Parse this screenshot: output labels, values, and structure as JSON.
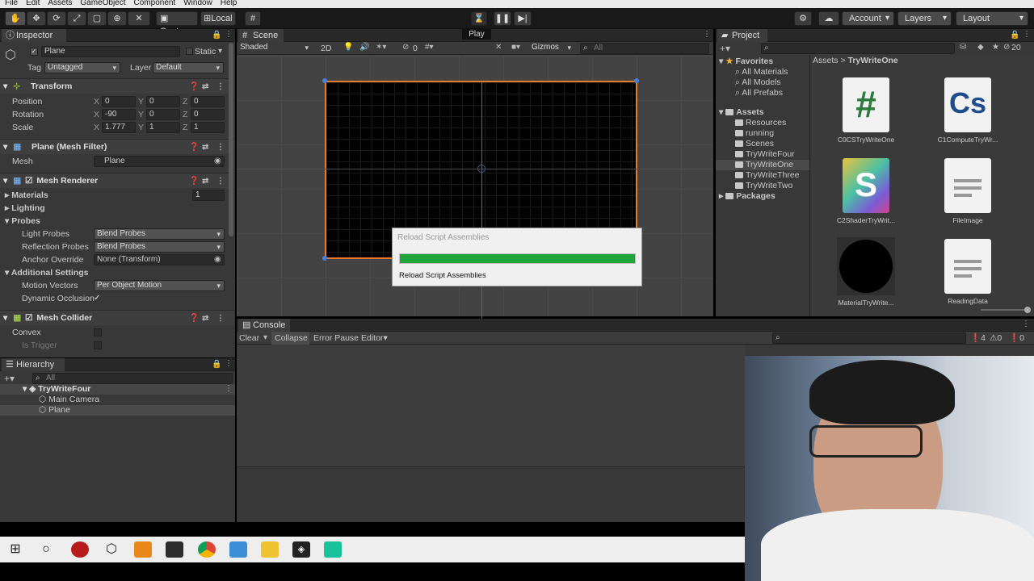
{
  "menu": [
    "File",
    "Edit",
    "Assets",
    "GameObject",
    "Component",
    "Window",
    "Help"
  ],
  "toolbar": {
    "center": "Center",
    "local": "Local",
    "play_label": "Play",
    "account": "Account",
    "layers": "Layers",
    "layout": "Layout"
  },
  "inspector": {
    "tab": "Inspector",
    "name": "Plane",
    "static": "Static",
    "tag_label": "Tag",
    "tag": "Untagged",
    "layer_label": "Layer",
    "layer": "Default",
    "transform": {
      "title": "Transform",
      "position": {
        "label": "Position",
        "x": "0",
        "y": "0",
        "z": "0"
      },
      "rotation": {
        "label": "Rotation",
        "x": "-90",
        "y": "0",
        "z": "0"
      },
      "scale": {
        "label": "Scale",
        "x": "1.777",
        "y": "1",
        "z": "1"
      }
    },
    "mesh_filter": {
      "title": "Plane (Mesh Filter)",
      "mesh_label": "Mesh",
      "mesh": "Plane"
    },
    "mesh_renderer": {
      "title": "Mesh Renderer",
      "materials": "Materials",
      "materials_count": "1",
      "lighting": "Lighting",
      "probes": "Probes",
      "light_probes_label": "Light Probes",
      "light_probes": "Blend Probes",
      "reflection_probes_label": "Reflection Probes",
      "reflection_probes": "Blend Probes",
      "anchor_label": "Anchor Override",
      "anchor": "None (Transform)",
      "additional": "Additional Settings",
      "motion_label": "Motion Vectors",
      "motion": "Per Object Motion",
      "dynamic_label": "Dynamic Occlusion"
    },
    "mesh_collider": {
      "title": "Mesh Collider",
      "convex": "Convex",
      "is_trigger": "Is Trigger"
    }
  },
  "hierarchy": {
    "tab": "Hierarchy",
    "search": "All",
    "scene": "TryWriteFour",
    "items": [
      "Main Camera",
      "Plane"
    ]
  },
  "scene": {
    "tab": "Scene",
    "shading": "Shaded",
    "mode2d": "2D",
    "hidden_count": "0",
    "gizmos": "Gizmos",
    "search": "All"
  },
  "dialog": {
    "title": "Reload Script Assemblies",
    "message": "Reload Script Assemblies",
    "progress": 1.0
  },
  "project": {
    "tab": "Project",
    "favorites": "Favorites",
    "fav_items": [
      "All Materials",
      "All Models",
      "All Prefabs"
    ],
    "assets": "Assets",
    "folders": [
      "Resources",
      "running",
      "Scenes",
      "TryWriteFour",
      "TryWriteOne",
      "TryWriteThree",
      "TryWriteTwo"
    ],
    "packages": "Packages",
    "breadcrumb_root": "Assets",
    "breadcrumb_current": "TryWriteOne",
    "count": "20",
    "files": [
      {
        "name": "C0CSTryWriteOne",
        "glyph": "#"
      },
      {
        "name": "C1ComputeTryWr...",
        "glyph": "Cs"
      },
      {
        "name": "C2ShaderTryWrit...",
        "glyph": "S"
      },
      {
        "name": "FileImage",
        "glyph": ""
      },
      {
        "name": "MaterialTryWrite...",
        "glyph": ""
      },
      {
        "name": "ReadingData",
        "glyph": ""
      }
    ]
  },
  "console": {
    "tab": "Console",
    "clear": "Clear",
    "collapse": "Collapse",
    "error_pause": "Error Pause",
    "editor": "Editor",
    "warn_count": "4",
    "info_count": "0",
    "error_count": "0"
  },
  "colors": {
    "accent": "#3d6ea8",
    "progress": "#1fa53a",
    "selection_outline": "#e87a2a"
  }
}
